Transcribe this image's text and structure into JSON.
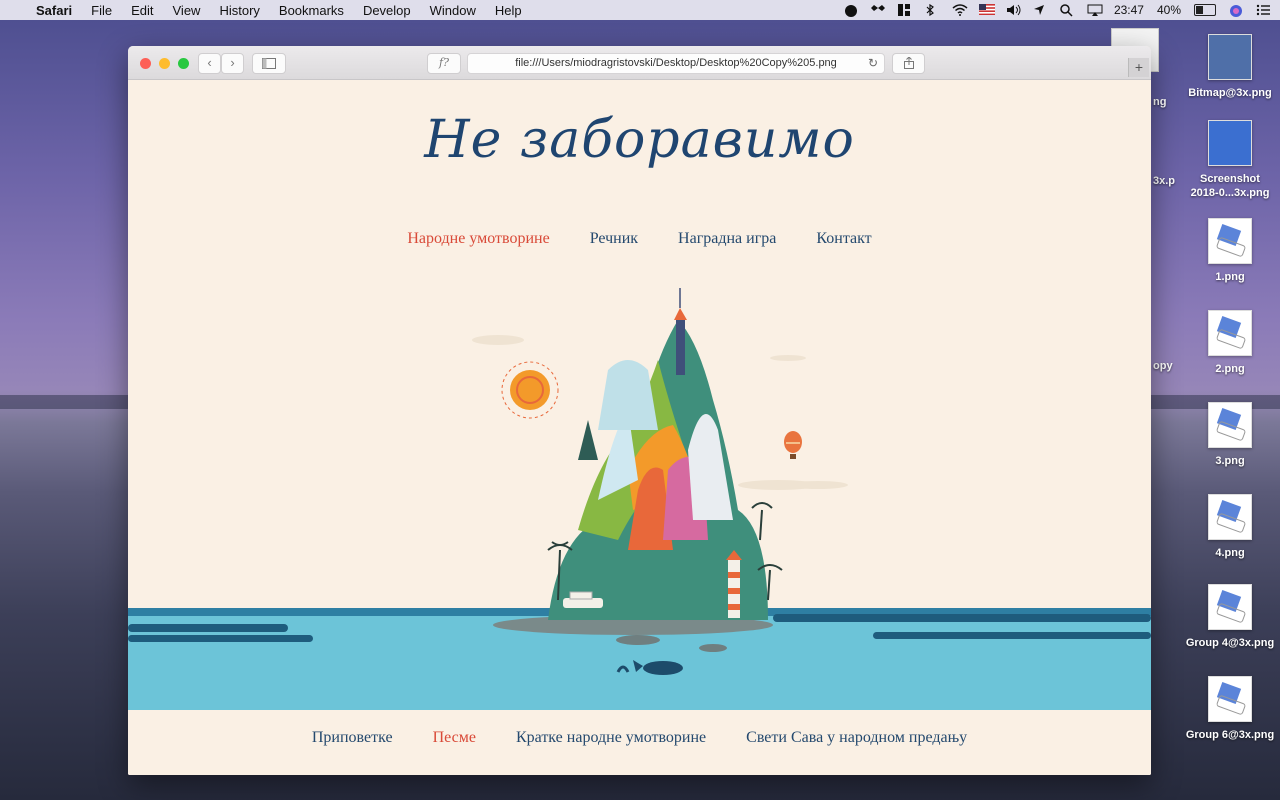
{
  "menubar": {
    "items": [
      "Safari",
      "File",
      "Edit",
      "View",
      "History",
      "Bookmarks",
      "Develop",
      "Window",
      "Help"
    ],
    "time": "23:47",
    "battery": "40%"
  },
  "desktop": {
    "icons": [
      {
        "label": "Bitmap@3x.png"
      },
      {
        "label": "Screenshot 2018-0...3x.png"
      },
      {
        "label": "1.png"
      },
      {
        "label": "2.png"
      },
      {
        "label": "3.png"
      },
      {
        "label": "4.png"
      },
      {
        "label": "Group 4@3x.png"
      },
      {
        "label": "Group 6@3x.png"
      }
    ],
    "partial_labels": [
      "ng",
      "3x.p",
      "opy"
    ]
  },
  "browser": {
    "url": "file:///Users/miodragristovski/Desktop/Desktop%20Copy%205.png",
    "reader_label": "f?"
  },
  "page": {
    "logo": "Не заборавимо",
    "nav": [
      "Народне умотворине",
      "Речник",
      "Наградна игра",
      "Контакт"
    ],
    "footer_nav": [
      "Приповетке",
      "Песме",
      "Кратке народне умотворине",
      "Свети Сава у народном предању"
    ]
  },
  "colors": {
    "accent": "#d94a38",
    "link": "#24496e",
    "page_bg": "#faf0e4",
    "sea": "#6cc4d8"
  }
}
